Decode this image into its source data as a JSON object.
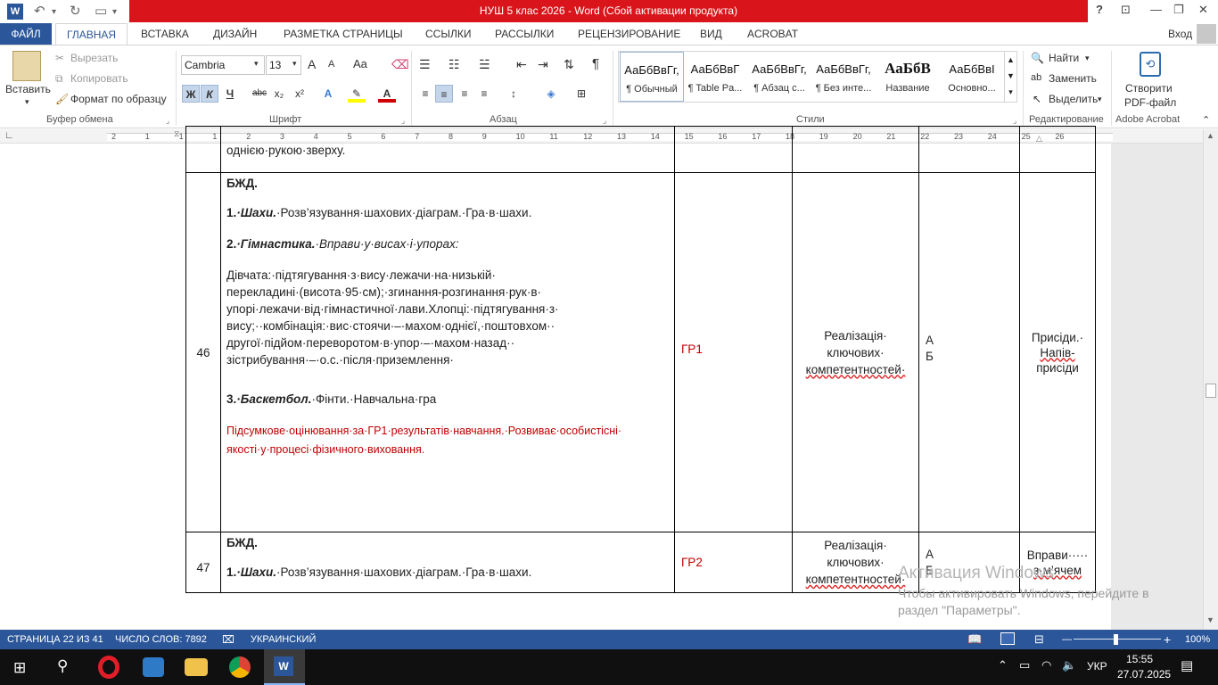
{
  "window": {
    "title": "НУШ 5 клас 2026 -  Word (Сбой активации продукта)",
    "app_icon": "W",
    "help": "?",
    "login": "Вход"
  },
  "tabs": [
    "ФАЙЛ",
    "ГЛАВНАЯ",
    "ВСТАВКА",
    "ДИЗАЙН",
    "РАЗМЕТКА СТРАНИЦЫ",
    "ССЫЛКИ",
    "РАССЫЛКИ",
    "РЕЦЕНЗИРОВАНИЕ",
    "ВИД",
    "ACROBAT"
  ],
  "ribbon": {
    "clipboard": {
      "paste": "Вставить",
      "cut": "Вырезать",
      "copy": "Копировать",
      "format_painter": "Формат по образцу",
      "label": "Буфер обмена"
    },
    "font": {
      "name": "Cambria",
      "size": "13",
      "bold": "Ж",
      "italic": "К",
      "underline": "Ч",
      "strike": "abc",
      "sub": "x₂",
      "sup": "x²",
      "label": "Шрифт",
      "aa": "Aa",
      "grow": "A",
      "shrink": "A"
    },
    "paragraph": {
      "label": "Абзац",
      "pilcrow": "¶"
    },
    "styles": {
      "label": "Стили",
      "items": [
        {
          "sample": "АаБбВвГг,",
          "name": "¶ Обычный"
        },
        {
          "sample": "АаБбВвГ",
          "name": "¶ Table Pa..."
        },
        {
          "sample": "АаБбВвГг,",
          "name": "¶ Абзац с..."
        },
        {
          "sample": "АаБбВвГг,",
          "name": "¶ Без инте..."
        },
        {
          "sample": "АаБбВ",
          "name": "Название"
        },
        {
          "sample": "АаБбВвI",
          "name": "Основно..."
        }
      ]
    },
    "editing": {
      "find": "Найти",
      "replace": "Заменить",
      "select": "Выделить",
      "label": "Редактирование"
    },
    "acrobat": {
      "create": "Создать PDF-файл",
      "create_line1": "Створити",
      "create_line2": "PDF-файл",
      "label": "Adobe Acrobat"
    }
  },
  "ruler": {
    "ticks": [
      "2",
      "1",
      "1",
      "1",
      "2",
      "3",
      "4",
      "5",
      "6",
      "7",
      "8",
      "9",
      "10",
      "11",
      "12",
      "13",
      "14",
      "15",
      "16",
      "17",
      "18",
      "19",
      "20",
      "21",
      "22",
      "23",
      "24",
      "25",
      "26"
    ]
  },
  "document": {
    "top_fragment": "однією·рукою·зверху.",
    "row46": {
      "num": "46",
      "heading": "БЖД.",
      "item1_num": "1.",
      "item1_bold": "·Шахи.",
      "item1_text": "·Розв’язування·шахових·діаграм.·Гра·в·шахи.",
      "item2_num": "2.",
      "item2_bold": "·Гімнастика.",
      "item2_text": "·Вправи·у·висах·і·упорах:",
      "para": "Дівчата:·підтягування·з·вису·лежачи·на·низькій· перекладині·(висота·95·см);·згинання-розгинання·рук·в· упорі·лежачи·від·гімнастичної·лави.Хлопці:·підтягування·з· вису;··комбінація:·вис·стоячи·–·махом·однієї,·поштовхом·· другої·підйом·переворотом·в·упор·–·махом·назад·· зістрибування·–·о.с.·після·приземлення·",
      "para_lines": [
        "Дівчата:·підтягування·з·вису·лежачи·на·низькій·",
        "перекладині·(висота·95·см);·згинання-розгинання·рук·в·",
        "упорі·лежачи·від·гімнастичної·лави.Хлопці:·підтягування·з·",
        "вису;··комбінація:·вис·стоячи·–·махом·однієї,·поштовхом··",
        "другої·підйом·переворотом·в·упор·–·махом·назад··",
        "зістрибування·–·о.с.·після·приземлення·"
      ],
      "item3_num": "3.",
      "item3_bold": "·Баскетбол.",
      "item3_text": "·Фінти.·Навчальна·гра",
      "assessment_line1": "Підсумкове·оцінювання·за·ГР1·результатів·навчання.·Розвиває·особистісні·",
      "assessment_line2": "якості·у·процесі·фізичного·виховання.",
      "group": "ГР1",
      "competence_line1": "Реалізація·",
      "competence_line2": "ключових·",
      "competence_line3": "компетентностей·",
      "ab_a": "А",
      "ab_b": "Б",
      "notes_line1": "Присіди.·",
      "notes_line2": "Напів-",
      "notes_line3": "присіди"
    },
    "row47": {
      "num": "47",
      "heading": "БЖД.",
      "item1_num": "1.",
      "item1_bold": "·Шахи.",
      "item1_text": "·Розв’язування·шахових·діаграм.·Гра·в·шахи.",
      "group": "ГР2",
      "competence_line1": "Реалізація·",
      "competence_line2": "ключових·",
      "competence_line3": "компетентностей·",
      "ab_a": "А",
      "ab_b": "Б",
      "notes_line1": "Вправи·····",
      "notes_line2": "з·м’ячем"
    }
  },
  "watermark": {
    "line1": "Активация Windows",
    "line2": "Чтобы активировать Windows, перейдите в",
    "line3": "раздел \"Параметры\"."
  },
  "status": {
    "page": "СТРАНИЦА 22 ИЗ 41",
    "words": "ЧИСЛО СЛОВ: 7892",
    "language": "УКРАИНСКИЙ",
    "zoom": "100%",
    "zoom_level": 1.0
  },
  "taskbar": {
    "time": "15:55",
    "date": "27.07.2025",
    "lang": "УКР"
  },
  "colors": {
    "word_blue": "#2b579a",
    "title_red": "#d9151b",
    "doc_red": "#c00000"
  }
}
